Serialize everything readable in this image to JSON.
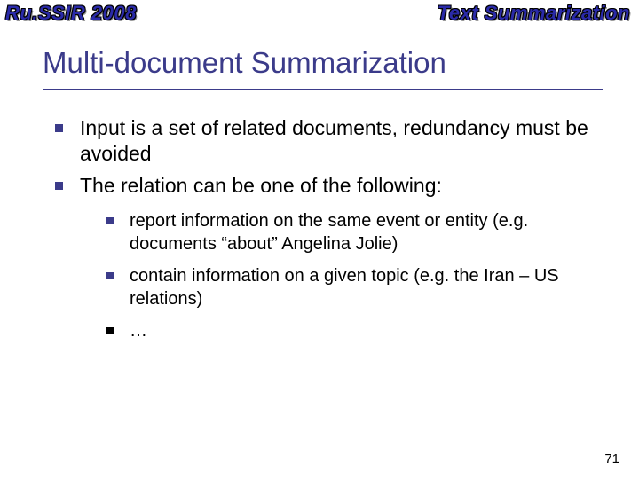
{
  "header": {
    "left": "Ru.SSIR 2008",
    "right": "Text Summarization"
  },
  "title": "Multi-document Summarization",
  "bullets": [
    "Input is a set of related documents, redundancy must be avoided",
    "The relation can be one of the following:"
  ],
  "subbullets": [
    "report information on the same event or entity (e.g. documents “about” Angelina Jolie)",
    "contain information on a given topic (e.g. the Iran – US relations)",
    "…"
  ],
  "page_number": "71"
}
